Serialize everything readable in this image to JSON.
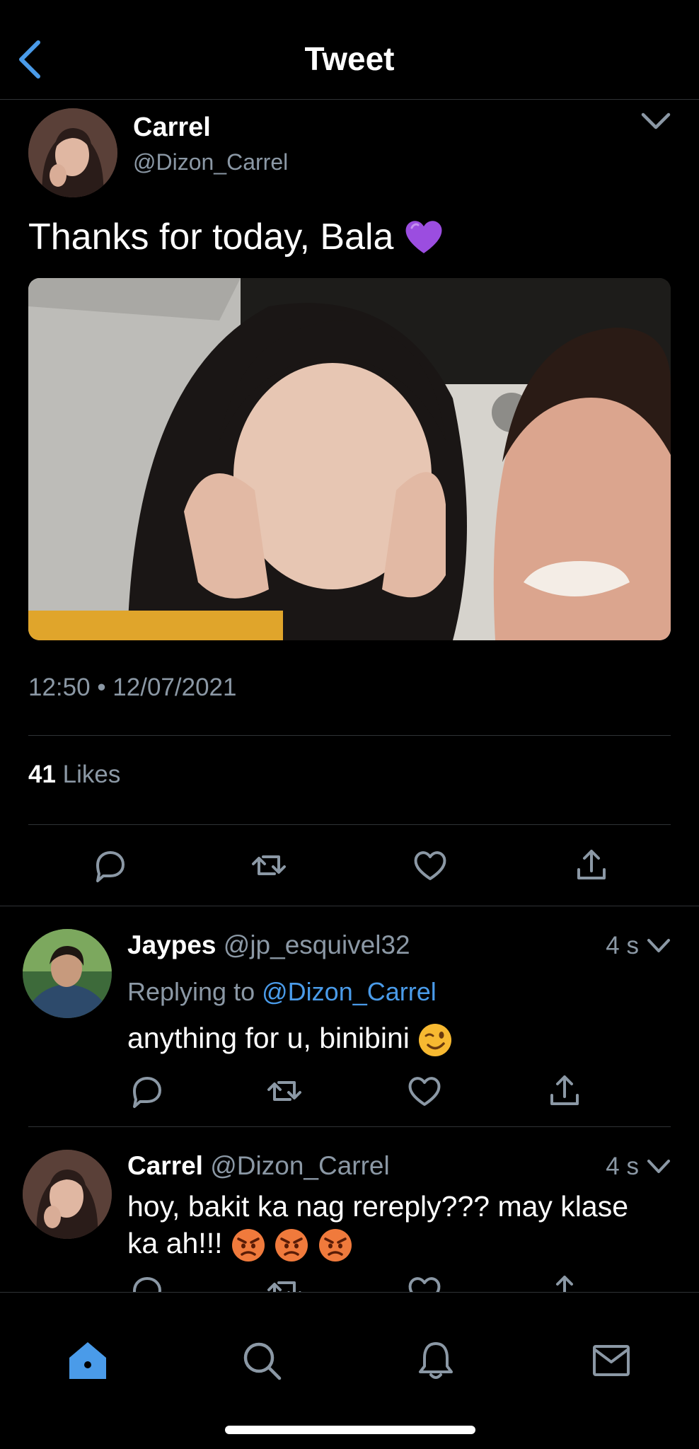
{
  "header": {
    "title": "Tweet",
    "back_icon": "chevron-left-icon"
  },
  "tweet": {
    "author_name": "Carrel",
    "author_handle": "@Dizon_Carrel",
    "text": "Thanks for today, Bala",
    "emoji": "purple-heart",
    "time": "12:50",
    "date": "12/07/2021",
    "likes_count": "41",
    "likes_label": "Likes"
  },
  "replies": [
    {
      "name": "Jaypes",
      "handle": "@jp_esquivel32",
      "time": "4 s",
      "replying_label": "Replying to",
      "replying_to": "@Dizon_Carrel",
      "text": "anything for u, binibini"
    },
    {
      "name": "Carrel",
      "handle": "@Dizon_Carrel",
      "time": "4 s",
      "text_line1": "hoy, bakit ka nag rereply??? may klase",
      "text_line2": "ka ah!!!"
    }
  ],
  "colors": {
    "accent": "#4a9be9",
    "muted": "#8b98a5",
    "divider": "#2f3336",
    "background": "#000000"
  },
  "tabbar": [
    "home-icon",
    "search-icon",
    "bell-icon",
    "mail-icon"
  ]
}
